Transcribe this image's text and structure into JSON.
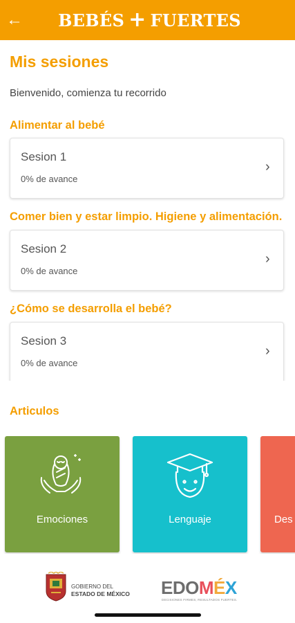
{
  "header": {
    "brand_left": "BEBÉS",
    "brand_plus": "+",
    "brand_right": "FUERTES"
  },
  "page": {
    "title": "Mis sesiones",
    "welcome": "Bienvenido, comienza tu recorrido"
  },
  "sections": [
    {
      "title": "Alimentar al bebé",
      "session": "Sesion 1",
      "progress": "0% de avance"
    },
    {
      "title": "Comer bien y estar limpio. Higiene y alimentación.",
      "session": "Sesion 2",
      "progress": "0% de avance"
    },
    {
      "title": "¿Cómo se desarrolla el bebé?",
      "session": "Sesion 3",
      "progress": "0% de avance"
    }
  ],
  "articles": {
    "title": "Articulos",
    "items": [
      {
        "label": "Emociones",
        "color": "#7AA040",
        "icon": "baby-in-hands-icon"
      },
      {
        "label": "Lenguaje",
        "color": "#16C0CC",
        "icon": "graduate-face-icon"
      },
      {
        "label": "Des",
        "color": "#EE6650",
        "icon": ""
      }
    ]
  },
  "footer": {
    "gob_line1": "GOBIERNO DEL",
    "gob_line2": "ESTADO DE MÉXICO",
    "edomex_brand": "EDOMÉX",
    "edomex_tagline": "DECISIONES FIRMES, RESULTADOS FUERTES."
  },
  "colors": {
    "accent": "#F49E00"
  }
}
